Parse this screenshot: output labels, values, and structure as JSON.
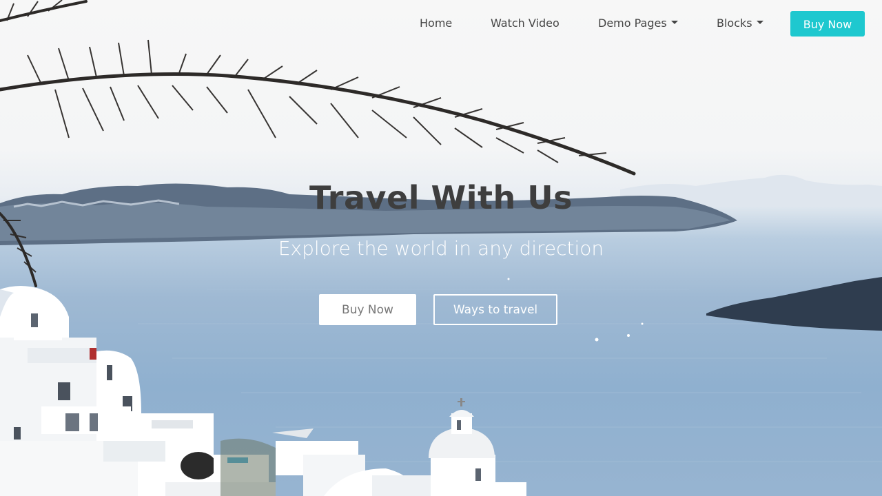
{
  "nav": {
    "items": [
      {
        "label": "Home",
        "has_dropdown": false
      },
      {
        "label": "Watch Video",
        "has_dropdown": false
      },
      {
        "label": "Demo Pages",
        "has_dropdown": true
      },
      {
        "label": "Blocks",
        "has_dropdown": true
      }
    ],
    "cta_label": "Buy Now"
  },
  "hero": {
    "title": "Travel With Us",
    "subtitle": "Explore the world in any direction",
    "primary_button": "Buy Now",
    "secondary_button": "Ways to travel"
  },
  "colors": {
    "accent": "#1ec8cf",
    "title_text": "#3e3e3e",
    "nav_text": "#444444"
  },
  "icons": {
    "dropdown": "caret-down-icon"
  }
}
